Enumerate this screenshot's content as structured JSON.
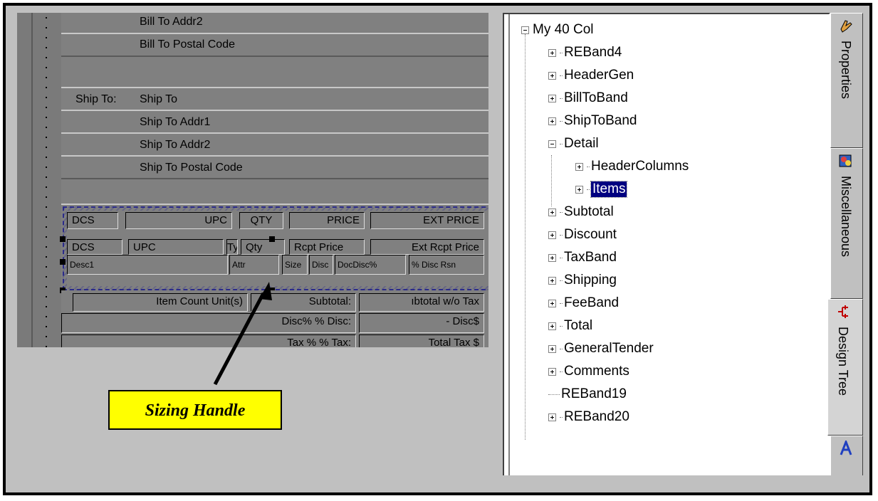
{
  "designer": {
    "bands": [
      {
        "label": "Bill To Addr2"
      },
      {
        "label": "Bill To Postal Code"
      },
      {
        "prefix": "Ship To:",
        "label": "Ship To"
      },
      {
        "label": "Ship To Addr1"
      },
      {
        "label": "Ship To Addr2"
      },
      {
        "label": "Ship To Postal Code"
      }
    ],
    "header_columns": [
      "DCS",
      "UPC",
      "QTY",
      "PRICE",
      "EXT PRICE"
    ],
    "item_columns": [
      "DCS",
      "UPC",
      "Ty",
      "Qty",
      "Rcpt Price",
      "Ext Rcpt Price"
    ],
    "item_row2": [
      "Desc1",
      "Attr",
      "Size",
      "Disc",
      "DocDisc%",
      "% Disc Rsn"
    ],
    "subtotal_row": [
      "Item Count  Unit(s)",
      "Subtotal:",
      "ıbtotal w/o Tax"
    ],
    "discount_row": [
      "Disc%  % Disc:",
      "-     Disc$"
    ],
    "tax_row": [
      "Tax %  % Tax:",
      "Total Tax $"
    ]
  },
  "callout": {
    "text": "Sizing Handle",
    "color": "#ffff00"
  },
  "tree": {
    "root": "My 40 Col",
    "items": [
      {
        "label": "REBand4",
        "level": 1,
        "expander": "plus"
      },
      {
        "label": "HeaderGen",
        "level": 1,
        "expander": "plus"
      },
      {
        "label": "BillToBand",
        "level": 1,
        "expander": "plus"
      },
      {
        "label": "ShipToBand",
        "level": 1,
        "expander": "plus"
      },
      {
        "label": "Detail",
        "level": 1,
        "expander": "minus"
      },
      {
        "label": "HeaderColumns",
        "level": 2,
        "expander": "plus"
      },
      {
        "label": "Items",
        "level": 2,
        "expander": "plus",
        "selected": true
      },
      {
        "label": "Subtotal",
        "level": 1,
        "expander": "plus"
      },
      {
        "label": "Discount",
        "level": 1,
        "expander": "plus"
      },
      {
        "label": "TaxBand",
        "level": 1,
        "expander": "plus"
      },
      {
        "label": "Shipping",
        "level": 1,
        "expander": "plus"
      },
      {
        "label": "FeeBand",
        "level": 1,
        "expander": "plus"
      },
      {
        "label": "Total",
        "level": 1,
        "expander": "plus"
      },
      {
        "label": "GeneralTender",
        "level": 1,
        "expander": "plus"
      },
      {
        "label": "Comments",
        "level": 1,
        "expander": "plus"
      },
      {
        "label": "REBand19",
        "level": 1,
        "expander": "none"
      },
      {
        "label": "REBand20",
        "level": 1,
        "expander": "plus"
      }
    ]
  },
  "tabs": [
    {
      "label": "Properties",
      "icon": "hand-icon"
    },
    {
      "label": "Miscellaneous",
      "icon": "palette-icon"
    },
    {
      "label": "Design Tree",
      "icon": "tree-icon",
      "active": true
    },
    {
      "label": "",
      "icon": "font-icon"
    }
  ]
}
